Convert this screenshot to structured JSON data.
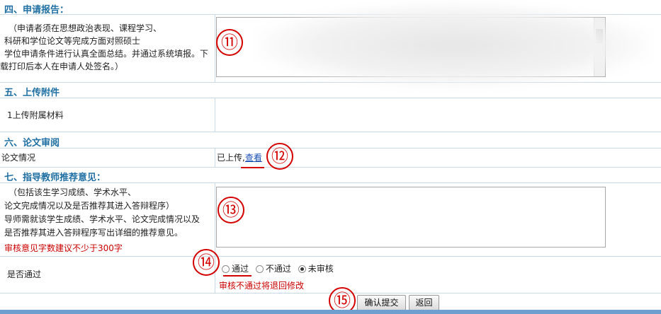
{
  "sections": {
    "report_title": "四、申请报告：",
    "attachments_title": "五、上传附件",
    "thesis_review_title": "六、论文审阅",
    "advisor_title": "七、指导教师推荐意见："
  },
  "report": {
    "instructions_lines": [
      "（申请者须在思想政治表现、课程学习、",
      "科研和学位论文等完成方面对照硕士",
      "学位申请条件进行认真全面总结。并通过系统填报。下",
      "载打印后本人在申请人处签名。）"
    ]
  },
  "attachments": {
    "label": "1上传附属材料"
  },
  "thesis": {
    "label": "论文情况",
    "status": "已上传,",
    "view_link": "查看"
  },
  "advisor": {
    "instructions_lines": [
      "（包括该生学习成绩、学术水平、",
      "论文完成情况以及是否推荐其进入答辩程序）",
      "导师需就该学生成绩、学术水平、论文完成情况以及",
      "是否推荐其进入答辩程序写出详细的推荐意见。"
    ],
    "hint": "审核意见字数建议不少于300字"
  },
  "approval": {
    "label": "是否通过",
    "options": [
      "通过",
      "不通过",
      "未审核"
    ],
    "selected": "未审核",
    "warning": "审核不通过将退回修改"
  },
  "buttons": {
    "confirm": "确认提交",
    "back": "返回"
  },
  "annotations": [
    "⑪",
    "⑫",
    "⑬",
    "⑭",
    "⑮"
  ],
  "colors": {
    "section_title": "#1f6fa3",
    "annotation_red": "#d40000",
    "link_blue": "#1a4fb5",
    "warning_red": "#cc0000"
  }
}
